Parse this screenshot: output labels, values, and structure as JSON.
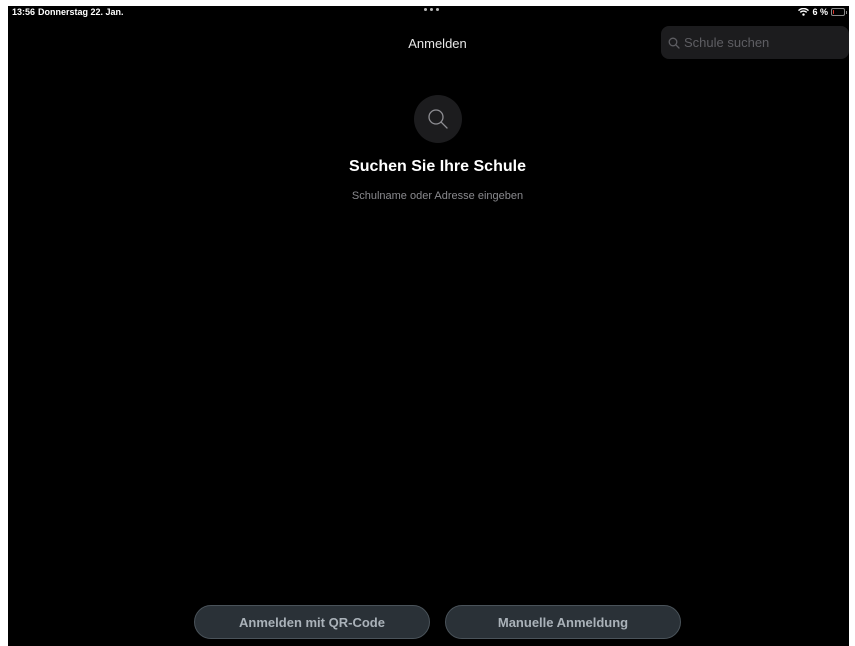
{
  "status_bar": {
    "time": "13:56",
    "date": "Donnerstag 22. Jan.",
    "battery_text": "6 %",
    "battery_level": 0.06,
    "battery_color": "#e0382e",
    "wifi_icon": "wifi-icon"
  },
  "nav": {
    "title": "Anmelden"
  },
  "search": {
    "placeholder": "Schule suchen",
    "value": "",
    "icon": "search-icon"
  },
  "empty_state": {
    "icon": "search-icon",
    "title": "Suchen Sie Ihre Schule",
    "subtitle": "Schulname oder Adresse eingeben"
  },
  "actions": {
    "qr_login_label": "Anmelden mit QR-Code",
    "manual_login_label": "Manuelle Anmeldung"
  },
  "colors": {
    "background": "#000000",
    "button_fill": "#2a3137",
    "button_text": "#aab2b9"
  }
}
